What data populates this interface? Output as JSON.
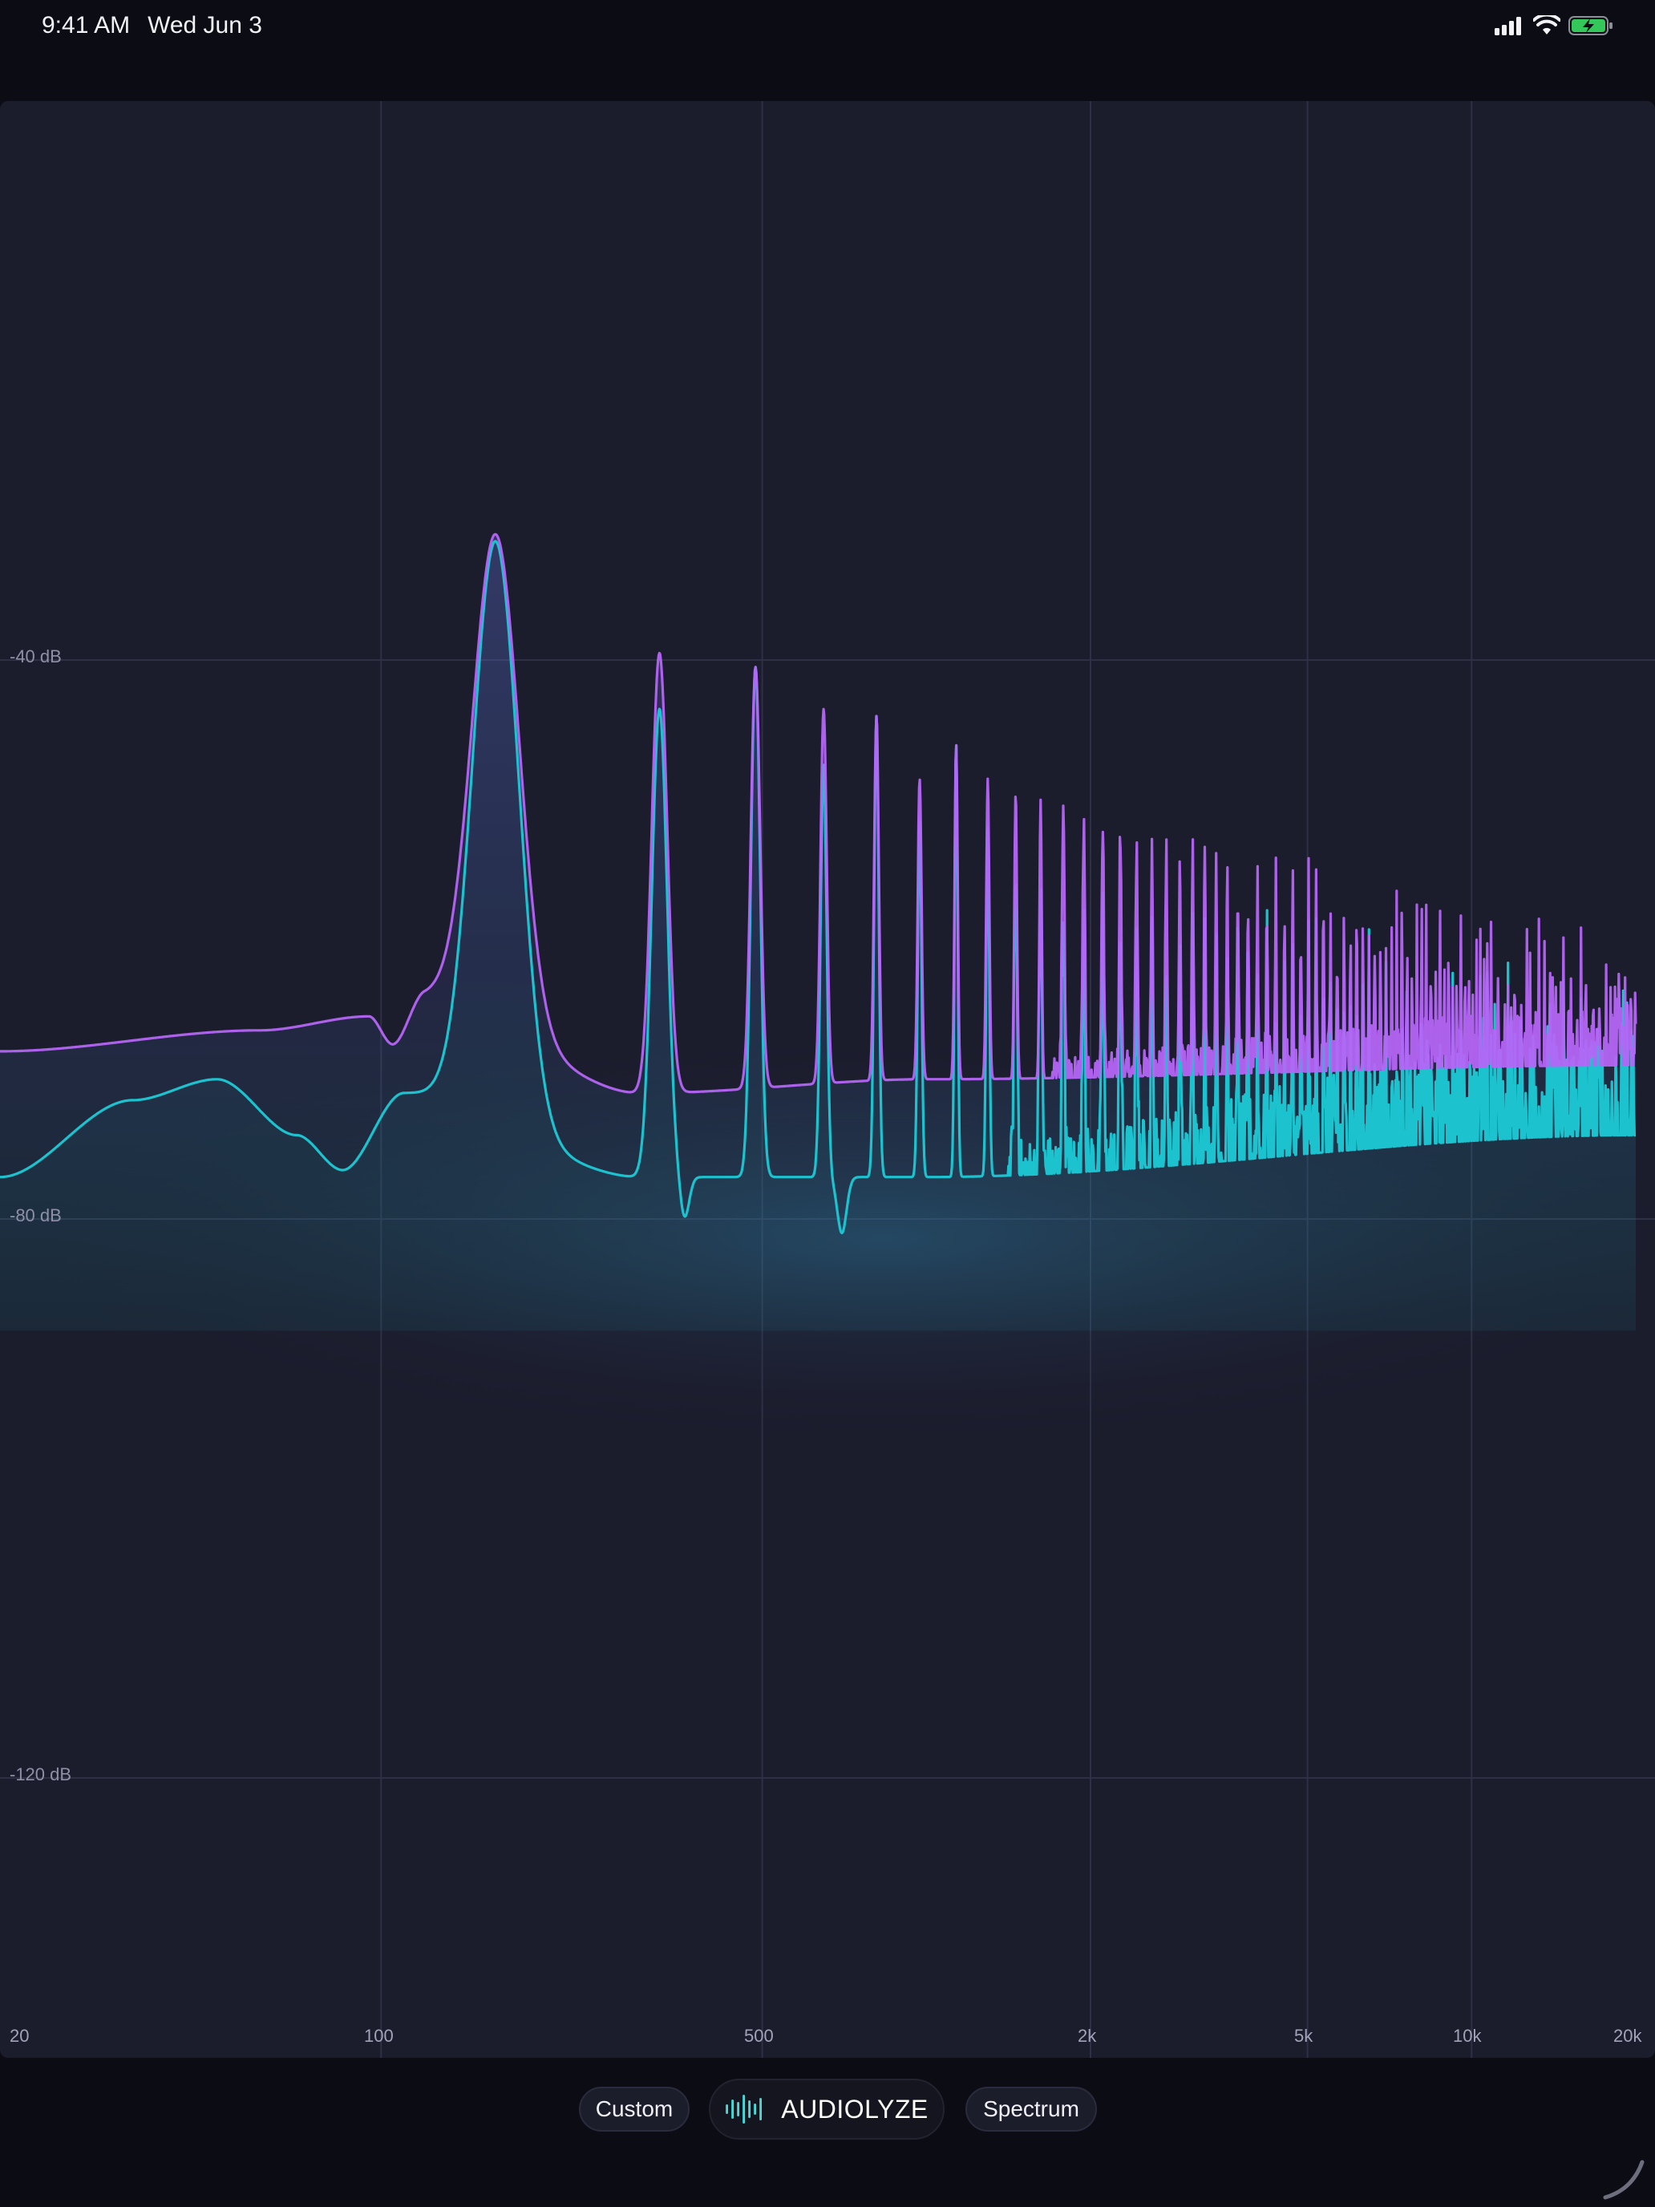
{
  "status_bar": {
    "time": "9:41 AM",
    "date": "Wed Jun 3",
    "icons": [
      "cellular-signal-icon",
      "wifi-icon",
      "battery-charging-icon"
    ],
    "battery_color": "#34c759"
  },
  "toolbar": {
    "left_chip": "Custom",
    "brand_name": "AUDIOLYZE",
    "brand_icon": "waveform-icon",
    "right_chip": "Spectrum"
  },
  "chart_data": {
    "type": "line",
    "x_scale": "log",
    "xlim": [
      20,
      20000
    ],
    "x_ticks": [
      {
        "value": 20,
        "label": "20"
      },
      {
        "value": 100,
        "label": "100"
      },
      {
        "value": 500,
        "label": "500"
      },
      {
        "value": 2000,
        "label": "2k"
      },
      {
        "value": 5000,
        "label": "5k"
      },
      {
        "value": 10000,
        "label": "10k"
      },
      {
        "value": 20000,
        "label": "20k"
      }
    ],
    "y_ticks": [
      {
        "value": -40,
        "label": "-40 dB"
      },
      {
        "value": -80,
        "label": "-80 dB"
      },
      {
        "value": -120,
        "label": "-120 dB"
      }
    ],
    "ylim": [
      -137,
      0
    ],
    "grid": true,
    "colors": {
      "series_a": "#b565f5",
      "series_b": "#1cc3cf",
      "grid": "#2f3045",
      "background": "#1b1c2c"
    },
    "fundamental_hz": 162,
    "series": [
      {
        "color": "#b565f5",
        "baseline": [
          [
            20,
            -68
          ],
          [
            60,
            -66.5
          ],
          [
            95,
            -65.5
          ],
          [
            105,
            -67.5
          ],
          [
            120,
            -64
          ],
          [
            300,
            -71
          ],
          [
            1000,
            -70
          ],
          [
            20000,
            -69
          ]
        ],
        "peaks": [
          {
            "f": 162,
            "db": -31,
            "width": 0.06
          },
          {
            "f": 324,
            "db": -39.5,
            "width": 0.02
          },
          {
            "f": 486,
            "db": -40.5,
            "width": 0.012
          },
          {
            "f": 648,
            "db": -43.5,
            "width": 0.008
          },
          {
            "f": 810,
            "db": -44,
            "width": 0.006
          },
          {
            "f": 972,
            "db": -48.5,
            "width": 0.005
          },
          {
            "f": 1134,
            "db": -46,
            "width": 0.004
          },
          {
            "f": 1296,
            "db": -48.5,
            "width": 0.004
          },
          {
            "f": 1458,
            "db": -49.5,
            "width": 0.0035
          },
          {
            "f": 1620,
            "db": -50,
            "width": 0.003
          }
        ],
        "tail": {
          "from_hz": 1700,
          "start_db": -51,
          "end_db": -64,
          "slope_to_hz": 20000
        }
      },
      {
        "color": "#1cc3cf",
        "baseline": [
          [
            20,
            -77
          ],
          [
            35,
            -71.5
          ],
          [
            50,
            -70
          ],
          [
            70,
            -74
          ],
          [
            85,
            -76.5
          ],
          [
            110,
            -71
          ],
          [
            300,
            -77
          ],
          [
            1000,
            -77
          ],
          [
            20000,
            -74
          ]
        ],
        "dips": [
          [
            330,
            -78
          ],
          [
            360,
            -80
          ],
          [
            520,
            -76
          ],
          [
            560,
            -74
          ],
          [
            700,
            -81
          ]
        ],
        "peaks": [
          {
            "f": 162,
            "db": -31.5,
            "width": 0.06
          },
          {
            "f": 324,
            "db": -43.5,
            "width": 0.02
          },
          {
            "f": 486,
            "db": -40.5,
            "width": 0.012
          },
          {
            "f": 648,
            "db": -47.5,
            "width": 0.008
          },
          {
            "f": 810,
            "db": -44,
            "width": 0.006
          },
          {
            "f": 972,
            "db": -51.5,
            "width": 0.005
          },
          {
            "f": 1134,
            "db": -46,
            "width": 0.004
          },
          {
            "f": 1296,
            "db": -52,
            "width": 0.004
          }
        ],
        "tail": {
          "from_hz": 1400,
          "start_db": -56,
          "end_db": -70,
          "slope_to_hz": 20000
        }
      }
    ]
  }
}
